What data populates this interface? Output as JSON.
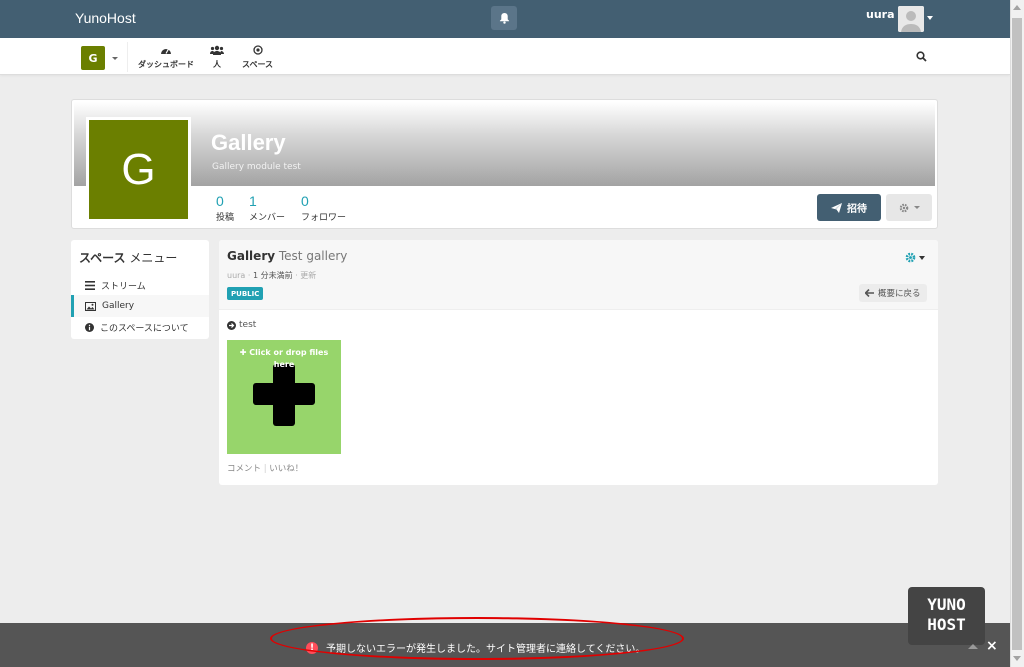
{
  "topbar": {
    "brand": "YunoHost",
    "user_name": "uura",
    "bell_icon": "bell-icon",
    "avatar_icon": "user-avatar-icon"
  },
  "nav": {
    "space_initial": "G",
    "items": [
      {
        "label": "ダッシュボード",
        "icon": "dashboard-icon"
      },
      {
        "label": "人",
        "icon": "users-icon"
      },
      {
        "label": "スペース",
        "icon": "dot-circle-icon"
      }
    ],
    "search_icon": "search-icon"
  },
  "space": {
    "initial": "G",
    "title": "Gallery",
    "description": "Gallery module test",
    "logo_color": "#6b7f00",
    "stats": [
      {
        "value": "0",
        "label": "投稿"
      },
      {
        "value": "1",
        "label": "メンバー"
      },
      {
        "value": "0",
        "label": "フォロワー"
      }
    ],
    "invite_label": "招待"
  },
  "space_menu": {
    "title_bold": "スペース",
    "title_rest": " メニュー",
    "items": [
      {
        "label": "ストリーム",
        "icon": "bars-icon"
      },
      {
        "label": "Gallery",
        "icon": "image-icon"
      },
      {
        "label": "このスペースについて",
        "icon": "info-circle-icon"
      }
    ]
  },
  "gallery": {
    "title_bold": "Gallery",
    "title_rest": " Test gallery",
    "meta_user": "uura",
    "meta_time": "1 分未満前",
    "meta_updated": "更新",
    "badge": "PUBLIC",
    "back_label": "概要に戻る",
    "folder_label": "test",
    "upload_label": "Click or drop files here",
    "comment_label": "コメント",
    "like_label": "いいね！",
    "upload_bg": "#97d56b"
  },
  "error": {
    "message": "予期しないエラーが発生しました。サイト管理者に連絡してください。",
    "close": "×"
  },
  "yunohost_logo": {
    "line1": "YUNO",
    "line2": "HOST"
  },
  "colors": {
    "accent": "#21a1b3",
    "header": "#435f72",
    "error": "#ff4d5a"
  }
}
